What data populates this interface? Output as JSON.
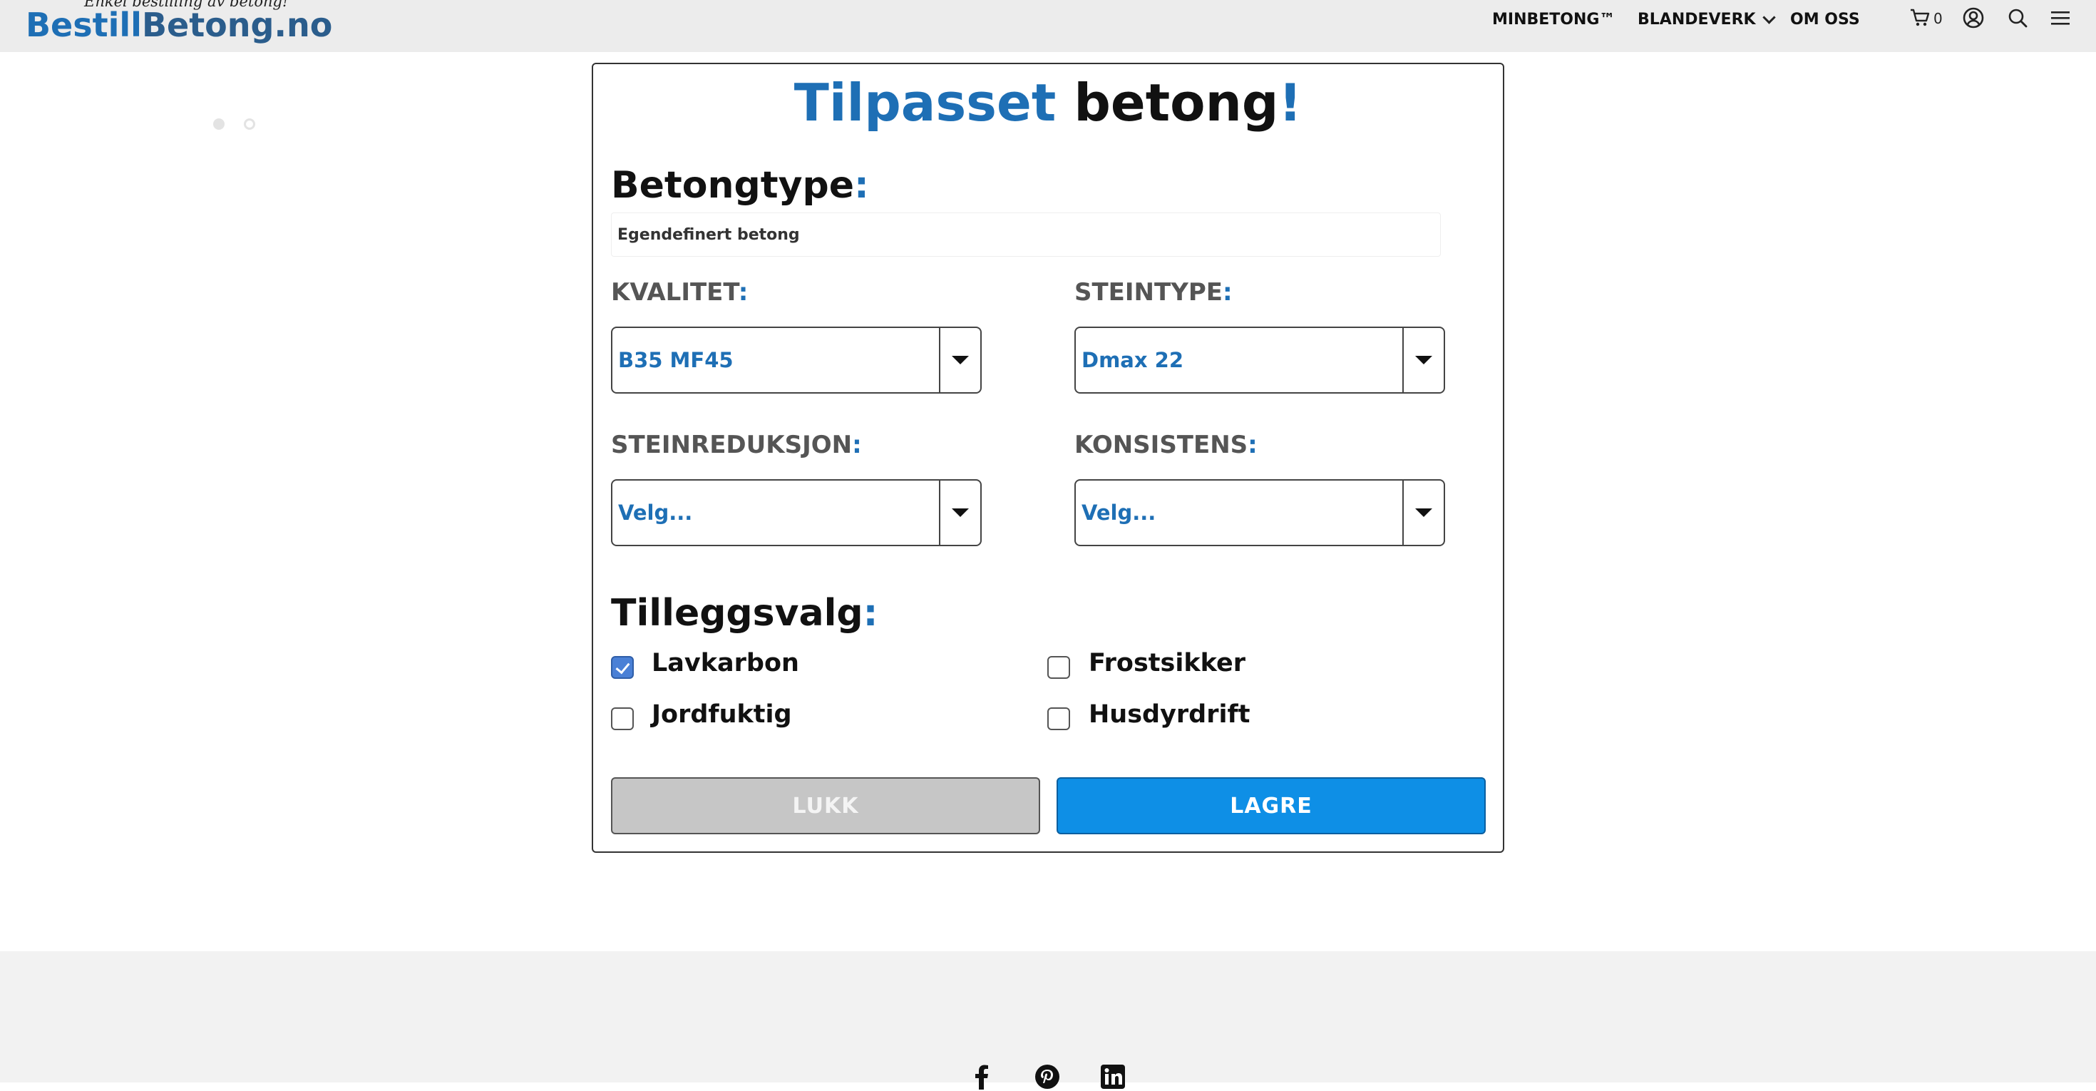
{
  "header": {
    "tagline": "Enkel bestilling av betong!",
    "logo_part1": "Bestill",
    "logo_part2": "Betong.no",
    "nav": {
      "minbetong": "MINBETONG™",
      "blandeverk": "BLANDEVERK",
      "omoss": "OM OSS"
    },
    "cart_count": "0",
    "icons": [
      "cart-icon",
      "user-icon",
      "search-icon",
      "menu-icon",
      "chevron-down-icon"
    ]
  },
  "slider": {
    "dots": 2,
    "active_index": 0
  },
  "modal": {
    "title_part1": "Tilpasset",
    "title_part2": "betong",
    "title_exclaim": "!",
    "betongtype_label": "Betongtype",
    "betongtype_value": "Egendefinert betong",
    "colon": ":",
    "kvalitet_label": "KVALITET",
    "kvalitet_value": "B35 MF45",
    "steintype_label": "STEINTYPE",
    "steintype_value": "Dmax 22",
    "steinreduksjon_label": "STEINREDUKSJON",
    "steinreduksjon_value": "Velg...",
    "konsistens_label": "KONSISTENS",
    "konsistens_value": "Velg...",
    "tilleggsvalg_label": "Tilleggsvalg",
    "options": [
      {
        "label": "Lavkarbon",
        "checked": true
      },
      {
        "label": "Frostsikker",
        "checked": false
      },
      {
        "label": "Jordfuktig",
        "checked": false
      },
      {
        "label": "Husdyrdrift",
        "checked": false
      }
    ],
    "close_label": "LUKK",
    "save_label": "LAGRE"
  },
  "colors": {
    "accent_blue": "#1e6fb5",
    "save_button": "#0e8fe6",
    "checkbox_checked": "#4a80d6",
    "header_bg": "#ececec",
    "footer_bg": "#f2f2f2"
  },
  "footer": {
    "social_icons": [
      "facebook-icon",
      "pinterest-icon",
      "linkedin-icon"
    ]
  }
}
